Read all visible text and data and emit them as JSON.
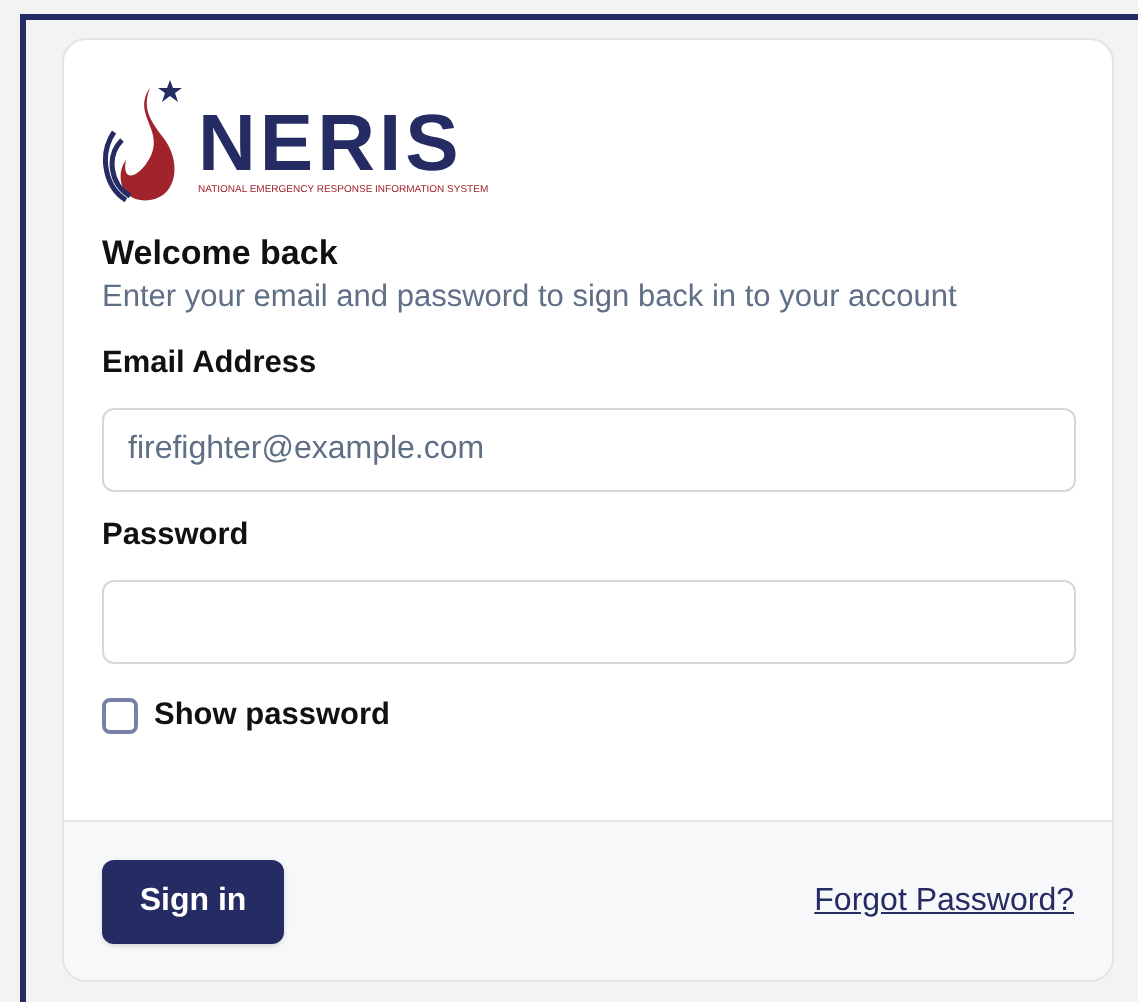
{
  "logo": {
    "name": "NERIS",
    "tagline": "NATIONAL EMERGENCY RESPONSE INFORMATION SYSTEM"
  },
  "heading": "Welcome back",
  "subheading": "Enter your email and password to sign back in to your account",
  "fields": [
    {
      "label": "Email Address",
      "placeholder": "firefighter@example.com"
    },
    {
      "label": "Password"
    }
  ],
  "show_password": {
    "label": "Show password",
    "checked": false
  },
  "sign_in": "Sign in",
  "forgot": "Forgot Password?"
}
